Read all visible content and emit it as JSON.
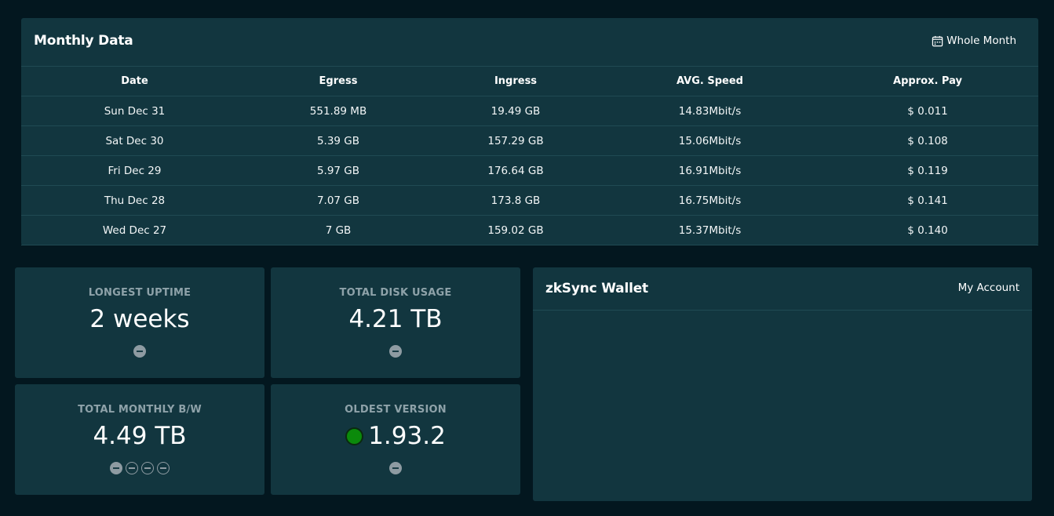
{
  "monthly": {
    "title": "Monthly Data",
    "period_button": "Whole Month",
    "columns": [
      "Date",
      "Egress",
      "Ingress",
      "AVG. Speed",
      "Approx. Pay"
    ],
    "rows": [
      [
        "Sun Dec 31",
        "551.89 MB",
        "19.49 GB",
        "14.83Mbit/s",
        "$ 0.011"
      ],
      [
        "Sat Dec 30",
        "5.39 GB",
        "157.29 GB",
        "15.06Mbit/s",
        "$ 0.108"
      ],
      [
        "Fri Dec 29",
        "5.97 GB",
        "176.64 GB",
        "16.91Mbit/s",
        "$ 0.119"
      ],
      [
        "Thu Dec 28",
        "7.07 GB",
        "173.8 GB",
        "16.75Mbit/s",
        "$ 0.141"
      ],
      [
        "Wed Dec 27",
        "7 GB",
        "159.02 GB",
        "15.37Mbit/s",
        "$ 0.140"
      ]
    ]
  },
  "cards": {
    "uptime": {
      "label": "LONGEST UPTIME",
      "value": "2 weeks",
      "indicators": [
        "filled"
      ]
    },
    "disk": {
      "label": "TOTAL DISK USAGE",
      "value": "4.21 TB",
      "indicators": [
        "filled"
      ]
    },
    "bandwidth": {
      "label": "TOTAL MONTHLY B/W",
      "value": "4.49 TB",
      "indicators": [
        "filled",
        "outline",
        "outline",
        "outline"
      ]
    },
    "version": {
      "label": "OLDEST VERSION",
      "value": "1.93.2",
      "status_color": "#0b8a0b",
      "indicators": [
        "filled"
      ]
    }
  },
  "wallet": {
    "title": "zkSync Wallet",
    "account_link": "My Account"
  },
  "icons": {
    "period_button": "calendar-icon",
    "indicator": "minus-circle-icon"
  },
  "colors": {
    "background": "#03171f",
    "panel": "#12363f",
    "muted_label": "#8ea2a9",
    "status_ok": "#0b8a0b"
  }
}
